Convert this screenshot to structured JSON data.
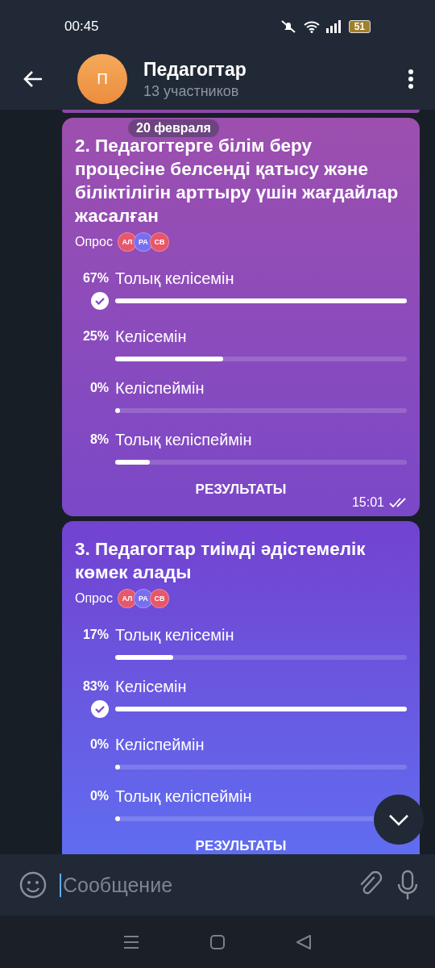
{
  "status_bar": {
    "time": "00:45",
    "battery": "51"
  },
  "header": {
    "avatar_letter": "П",
    "title": "Педагогтар",
    "subtitle": "13 участников"
  },
  "date_pill": "20 февраля",
  "polls": [
    {
      "title": "2. Педагогтерге білім беру процесіне белсенді қатысу және біліктілігін арттыру үшін жағдайлар жасалған",
      "type_label": "Опрос",
      "voters": [
        {
          "initials": "АЛ",
          "color": "#e8566a"
        },
        {
          "initials": "РА",
          "color": "#7a6ef0"
        },
        {
          "initials": "СВ",
          "color": "#e8566a"
        }
      ],
      "options": [
        {
          "percent": "67%",
          "label": "Толық келісемін",
          "level": 1.0,
          "selected": true
        },
        {
          "percent": "25%",
          "label": "Келісемін",
          "level": 0.37,
          "selected": false
        },
        {
          "percent": "0%",
          "label": "Келіспеймін",
          "level": 0,
          "selected": false
        },
        {
          "percent": "8%",
          "label": "Толық келіспеймін",
          "level": 0.12,
          "selected": false
        }
      ],
      "results_button": "РЕЗУЛЬТАТЫ",
      "time": "15:01",
      "read": true
    },
    {
      "title": "3. Педагогтар тиімді әдістемелік көмек алады",
      "type_label": "Опрос",
      "voters": [
        {
          "initials": "АЛ",
          "color": "#e8566a"
        },
        {
          "initials": "РА",
          "color": "#7a6ef0"
        },
        {
          "initials": "СВ",
          "color": "#e8566a"
        }
      ],
      "options": [
        {
          "percent": "17%",
          "label": "Толық келісемін",
          "level": 0.2,
          "selected": false
        },
        {
          "percent": "83%",
          "label": "Келісемін",
          "level": 1.0,
          "selected": true
        },
        {
          "percent": "0%",
          "label": "Келіспеймін",
          "level": 0,
          "selected": false
        },
        {
          "percent": "0%",
          "label": "Толық келіспеймін",
          "level": 0,
          "selected": false
        }
      ],
      "results_button": "РЕЗУЛЬТАТЫ"
    }
  ],
  "input": {
    "placeholder": "Сообщение"
  }
}
